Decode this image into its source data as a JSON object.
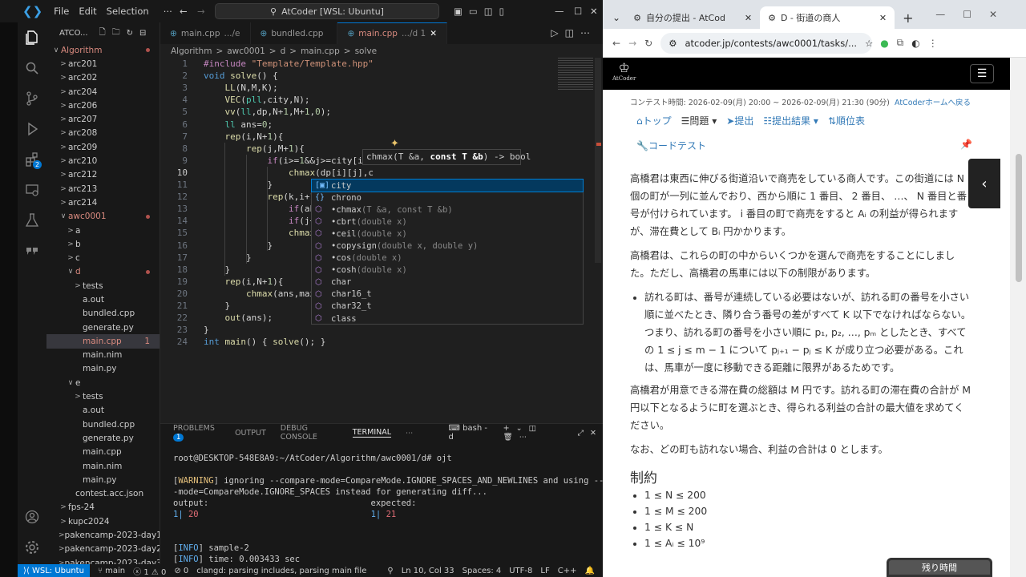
{
  "vscode": {
    "menu": [
      "File",
      "Edit",
      "Selection",
      "⋯"
    ],
    "command_center": "AtCoder [WSL: Ubuntu]",
    "explorer_title": "ATCO...",
    "tree": [
      {
        "label": "Algorithm",
        "indent": 0,
        "chev": "∨",
        "dot": true,
        "accent": true
      },
      {
        "label": "arc201",
        "indent": 1,
        "chev": ">"
      },
      {
        "label": "arc202",
        "indent": 1,
        "chev": ">"
      },
      {
        "label": "arc204",
        "indent": 1,
        "chev": ">"
      },
      {
        "label": "arc206",
        "indent": 1,
        "chev": ">"
      },
      {
        "label": "arc207",
        "indent": 1,
        "chev": ">"
      },
      {
        "label": "arc208",
        "indent": 1,
        "chev": ">"
      },
      {
        "label": "arc209",
        "indent": 1,
        "chev": ">"
      },
      {
        "label": "arc210",
        "indent": 1,
        "chev": ">"
      },
      {
        "label": "arc212",
        "indent": 1,
        "chev": ">"
      },
      {
        "label": "arc213",
        "indent": 1,
        "chev": ">"
      },
      {
        "label": "arc214",
        "indent": 1,
        "chev": ">"
      },
      {
        "label": "awc0001",
        "indent": 1,
        "chev": "∨",
        "dot": true,
        "accent": true
      },
      {
        "label": "a",
        "indent": 2,
        "chev": ">"
      },
      {
        "label": "b",
        "indent": 2,
        "chev": ">"
      },
      {
        "label": "c",
        "indent": 2,
        "chev": ">"
      },
      {
        "label": "d",
        "indent": 2,
        "chev": "∨",
        "dot": true,
        "accent": true
      },
      {
        "label": "tests",
        "indent": 3,
        "chev": ">"
      },
      {
        "label": "a.out",
        "indent": 3,
        "chev": ""
      },
      {
        "label": "bundled.cpp",
        "indent": 3,
        "chev": ""
      },
      {
        "label": "generate.py",
        "indent": 3,
        "chev": ""
      },
      {
        "label": "main.cpp",
        "indent": 3,
        "chev": "",
        "sel": true,
        "badge": "1",
        "accent": true
      },
      {
        "label": "main.nim",
        "indent": 3,
        "chev": ""
      },
      {
        "label": "main.py",
        "indent": 3,
        "chev": ""
      },
      {
        "label": "e",
        "indent": 2,
        "chev": "∨"
      },
      {
        "label": "tests",
        "indent": 3,
        "chev": ">"
      },
      {
        "label": "a.out",
        "indent": 3,
        "chev": ""
      },
      {
        "label": "bundled.cpp",
        "indent": 3,
        "chev": ""
      },
      {
        "label": "generate.py",
        "indent": 3,
        "chev": ""
      },
      {
        "label": "main.cpp",
        "indent": 3,
        "chev": ""
      },
      {
        "label": "main.nim",
        "indent": 3,
        "chev": ""
      },
      {
        "label": "main.py",
        "indent": 3,
        "chev": ""
      },
      {
        "label": "contest.acc.json",
        "indent": 2,
        "chev": ""
      },
      {
        "label": "fps-24",
        "indent": 1,
        "chev": ">"
      },
      {
        "label": "kupc2024",
        "indent": 1,
        "chev": ">"
      },
      {
        "label": "pakencamp-2023-day1",
        "indent": 1,
        "chev": ">"
      },
      {
        "label": "pakencamp-2023-day2",
        "indent": 1,
        "chev": ">"
      },
      {
        "label": "pakencamp-2023-day3",
        "indent": 1,
        "chev": ">"
      }
    ],
    "tabs": [
      {
        "label": "main.cpp",
        "sub": ".../e",
        "active": false
      },
      {
        "label": "bundled.cpp",
        "sub": "",
        "active": false
      },
      {
        "label": "main.cpp",
        "sub": ".../d 1",
        "active": true
      }
    ],
    "breadcrumb": [
      "Algorithm",
      ">",
      "awc0001",
      ">",
      "d",
      ">",
      "main.cpp",
      ">",
      "solve"
    ],
    "code_lines": [
      "1",
      "2",
      "3",
      "4",
      "5",
      "6",
      "7",
      "8",
      "9",
      "10",
      "11",
      "12",
      "13",
      "14",
      "15",
      "16",
      "17",
      "18",
      "19",
      "20",
      "21",
      "22",
      "23",
      "24"
    ],
    "signature_hint": "chmax(T &a, const T &b) -> bool",
    "suggestions": [
      {
        "icon": "[▣]",
        "name": "city",
        "detail": "",
        "sel": true
      },
      {
        "icon": "{}",
        "name": "chrono",
        "detail": ""
      },
      {
        "icon": "⬡",
        "name": "•chmax",
        "detail": "(T &a, const T &b)"
      },
      {
        "icon": "⬡",
        "name": "•cbrt",
        "detail": "(double x)"
      },
      {
        "icon": "⬡",
        "name": "•ceil",
        "detail": "(double x)"
      },
      {
        "icon": "⬡",
        "name": "•copysign",
        "detail": "(double x, double y)"
      },
      {
        "icon": "⬡",
        "name": "•cos",
        "detail": "(double x)"
      },
      {
        "icon": "⬡",
        "name": "•cosh",
        "detail": "(double x)"
      },
      {
        "icon": "⬡",
        "name": "char",
        "detail": ""
      },
      {
        "icon": "⬡",
        "name": "char16_t",
        "detail": ""
      },
      {
        "icon": "⬡",
        "name": "char32_t",
        "detail": ""
      },
      {
        "icon": "⬡",
        "name": "class",
        "detail": ""
      }
    ],
    "panel_tabs": [
      "PROBLEMS",
      "OUTPUT",
      "DEBUG CONSOLE",
      "TERMINAL"
    ],
    "problems_count": "1",
    "terminal_name": "bash - d",
    "terminal_lines": [
      "root@DESKTOP-548E8A9:~/AtCoder/Algorithm/awc0001/d# ojt",
      "",
      "[WARNING] ignoring --compare-mode=CompareMode.IGNORE_SPACES_AND_NEWLINES and using --compare",
      "-mode=CompareMode.IGNORE_SPACES instead for generating diff...",
      "output:                                expected:",
      "1| 20                                  1| 21",
      "",
      "",
      "[INFO] sample-2",
      "[INFO] time: 0.003433 sec"
    ],
    "status": {
      "remote": "WSL: Ubuntu",
      "branch": "main",
      "errors": "ⓧ 1 ⚠ 0",
      "ports": "⊘ 0",
      "clangd": "clangd: parsing includes, parsing main file",
      "position": "Ln 10, Col 33",
      "spaces": "Spaces: 4",
      "encoding": "UTF-8",
      "eol": "LF",
      "lang": "C++"
    }
  },
  "chrome": {
    "tabs": [
      {
        "label": "自分の提出 - AtCod",
        "active": false
      },
      {
        "label": "D - 街道の商人",
        "active": true
      }
    ],
    "url": "atcoder.jp/contests/awc0001/tasks/...",
    "logo_text": "AtCoder",
    "contest_time": "コンテスト時間: 2026-02-09(月) 20:00 ~ 2026-02-09(月) 21:30 (90分)",
    "home_link": "AtCoderホームへ戻る",
    "nav": [
      "トップ",
      "問題 ▾",
      "提出",
      "提出結果 ▾",
      "順位表",
      "コードテスト"
    ],
    "para1": "高橋君は東西に伸びる街道沿いで商売をしている商人です。この街道には N 個の町が一列に並んでおり、西から順に 1 番目、 2 番目、 …、 N 番目と番号が付けられています。 i 番目の町で商売をすると Aᵢ の利益が得られますが、滞在費として Bᵢ 円かかります。",
    "para2": "高橋君は、これらの町の中からいくつかを選んで商売をすることにしました。ただし、高橋君の馬車には以下の制限があります。",
    "bullet": "訪れる町は、番号が連続している必要はないが、訪れる町の番号を小さい順に並べたとき、隣り合う番号の差がすべて K 以下でなければならない。つまり、訪れる町の番号を小さい順に p₁, p₂, …, pₘ としたとき、すべての 1 ≤ j ≤ m − 1 について pⱼ₊₁ − pⱼ ≤ K が成り立つ必要がある。これは、馬車が一度に移動できる距離に限界があるためです。",
    "para3": "高橋君が用意できる滞在費の総額は M 円です。訪れる町の滞在費の合計が M 円以下となるように町を選ぶとき、得られる利益の合計の最大値を求めてください。",
    "para4": "なお、どの町も訪れない場合、利益の合計は 0 とします。",
    "constraints_title": "制約",
    "constraints": [
      "1 ≤ N ≤ 200",
      "1 ≤ M ≤ 200",
      "1 ≤ K ≤ N",
      "1 ≤ Aᵢ ≤ 10⁹"
    ],
    "timer_label": "残り時間"
  }
}
